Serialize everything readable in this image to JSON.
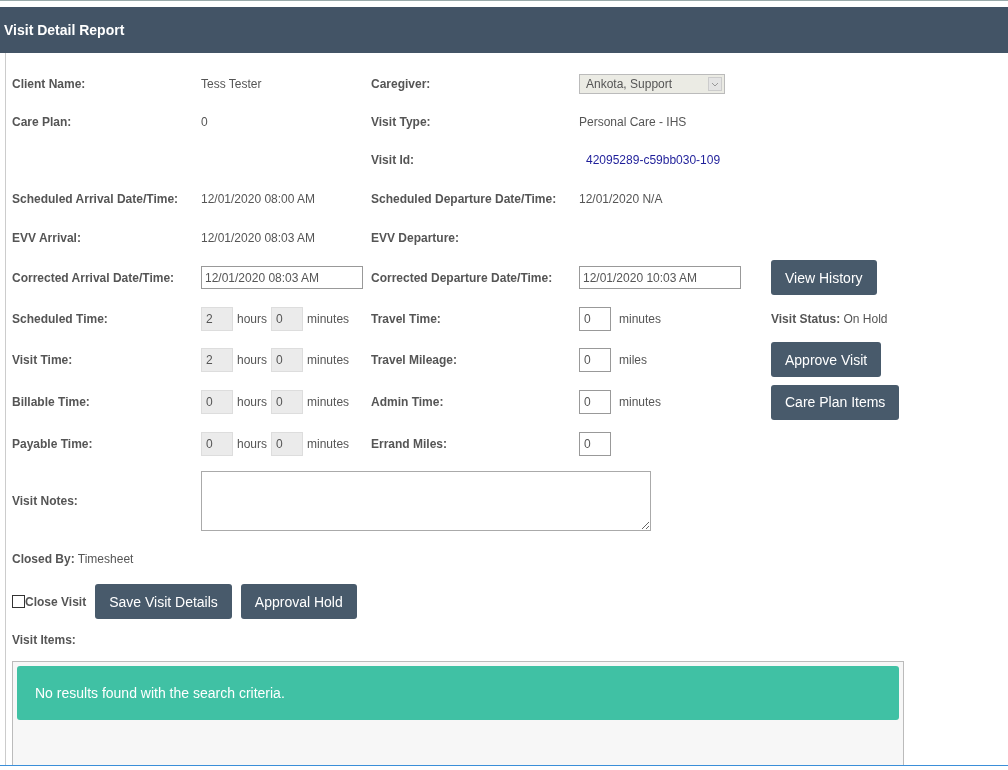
{
  "header": {
    "title": "Visit Detail Report"
  },
  "rows": [
    {
      "left": {
        "label": "Client Name:",
        "kind": "text",
        "value": "Tess Tester"
      },
      "right": {
        "label": "Caregiver:",
        "kind": "select",
        "value": "Ankota, Support",
        "disabled": true
      }
    },
    {
      "left": {
        "label": "Care Plan:",
        "kind": "text",
        "value": "0"
      },
      "right": {
        "label": "Visit Type:",
        "kind": "text",
        "value": "Personal Care - IHS"
      }
    },
    {
      "right": {
        "label": "Visit Id:",
        "kind": "link",
        "value": "42095289-c59bb030-109"
      }
    },
    {
      "left": {
        "label": "Scheduled Arrival Date/Time:",
        "kind": "text",
        "value": "12/01/2020 08:00 AM"
      },
      "right": {
        "label": "Scheduled Departure Date/Time:",
        "kind": "text",
        "value": "12/01/2020 N/A"
      }
    },
    {
      "left": {
        "label": "EVV Arrival:",
        "kind": "text",
        "value": "12/01/2020 08:03 AM"
      },
      "right": {
        "label": "EVV Departure:",
        "kind": "text"
      }
    },
    {
      "left": {
        "label": "Corrected Arrival Date/Time:",
        "kind": "input",
        "value": "12/01/2020 08:03 AM"
      },
      "right": {
        "label": "Corrected Departure Date/Time:",
        "kind": "input",
        "value": "12/01/2020 10:03 AM"
      },
      "side": {
        "kind": "button",
        "label": "View History"
      }
    },
    {
      "left": {
        "label": "Scheduled Time:",
        "kind": "duration",
        "hours": "2",
        "hours_unit": "hours",
        "minutes": "0",
        "minutes_unit": "minutes",
        "disabled": true
      },
      "right": {
        "label": "Travel Time:",
        "kind": "number",
        "value": "0",
        "unit": "minutes"
      },
      "side": {
        "kind": "status",
        "label": "Visit Status:",
        "value": "On Hold"
      }
    },
    {
      "left": {
        "label": "Visit Time:",
        "kind": "duration",
        "hours": "2",
        "hours_unit": "hours",
        "minutes": "0",
        "minutes_unit": "minutes",
        "disabled": true
      },
      "right": {
        "label": "Travel Mileage:",
        "kind": "number",
        "value": "0",
        "unit": "miles"
      },
      "side": {
        "kind": "button",
        "label": "Approve Visit"
      }
    },
    {
      "left": {
        "label": "Billable Time:",
        "kind": "duration",
        "hours": "0",
        "hours_unit": "hours",
        "minutes": "0",
        "minutes_unit": "minutes",
        "disabled": true
      },
      "right": {
        "label": "Admin Time:",
        "kind": "number",
        "value": "0",
        "unit": "minutes"
      },
      "side": {
        "kind": "button",
        "label": "Care Plan Items"
      }
    },
    {
      "left": {
        "label": "Payable Time:",
        "kind": "duration",
        "hours": "0",
        "hours_unit": "hours",
        "minutes": "0",
        "minutes_unit": "minutes",
        "disabled": true
      },
      "right": {
        "label": "Errand Miles:",
        "kind": "number",
        "value": "0"
      }
    },
    {
      "left": {
        "label": "Visit Notes:",
        "kind": "textarea"
      }
    }
  ],
  "closed_by": {
    "label": "Closed By:",
    "value": "Timesheet"
  },
  "close_visit": {
    "label": "Close Visit",
    "checked": false
  },
  "actions": [
    "Save Visit Details",
    "Approval Hold"
  ],
  "visit_items": {
    "label": "Visit Items:",
    "message": "No results found with the search criteria."
  }
}
